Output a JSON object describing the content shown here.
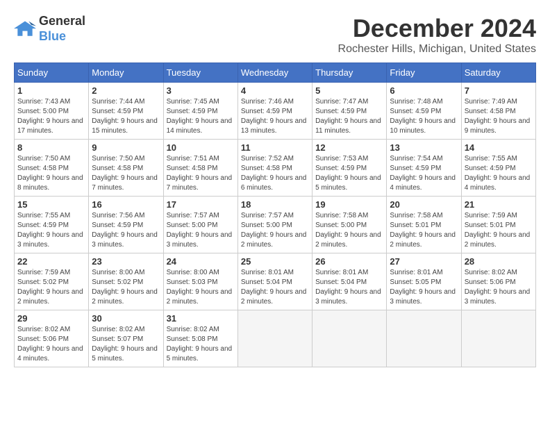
{
  "logo": {
    "line1": "General",
    "line2": "Blue"
  },
  "title": "December 2024",
  "location": "Rochester Hills, Michigan, United States",
  "weekdays": [
    "Sunday",
    "Monday",
    "Tuesday",
    "Wednesday",
    "Thursday",
    "Friday",
    "Saturday"
  ],
  "weeks": [
    [
      {
        "day": "1",
        "sunrise": "7:43 AM",
        "sunset": "5:00 PM",
        "daylight": "9 hours and 17 minutes."
      },
      {
        "day": "2",
        "sunrise": "7:44 AM",
        "sunset": "4:59 PM",
        "daylight": "9 hours and 15 minutes."
      },
      {
        "day": "3",
        "sunrise": "7:45 AM",
        "sunset": "4:59 PM",
        "daylight": "9 hours and 14 minutes."
      },
      {
        "day": "4",
        "sunrise": "7:46 AM",
        "sunset": "4:59 PM",
        "daylight": "9 hours and 13 minutes."
      },
      {
        "day": "5",
        "sunrise": "7:47 AM",
        "sunset": "4:59 PM",
        "daylight": "9 hours and 11 minutes."
      },
      {
        "day": "6",
        "sunrise": "7:48 AM",
        "sunset": "4:59 PM",
        "daylight": "9 hours and 10 minutes."
      },
      {
        "day": "7",
        "sunrise": "7:49 AM",
        "sunset": "4:58 PM",
        "daylight": "9 hours and 9 minutes."
      }
    ],
    [
      {
        "day": "8",
        "sunrise": "7:50 AM",
        "sunset": "4:58 PM",
        "daylight": "9 hours and 8 minutes."
      },
      {
        "day": "9",
        "sunrise": "7:50 AM",
        "sunset": "4:58 PM",
        "daylight": "9 hours and 7 minutes."
      },
      {
        "day": "10",
        "sunrise": "7:51 AM",
        "sunset": "4:58 PM",
        "daylight": "9 hours and 7 minutes."
      },
      {
        "day": "11",
        "sunrise": "7:52 AM",
        "sunset": "4:58 PM",
        "daylight": "9 hours and 6 minutes."
      },
      {
        "day": "12",
        "sunrise": "7:53 AM",
        "sunset": "4:59 PM",
        "daylight": "9 hours and 5 minutes."
      },
      {
        "day": "13",
        "sunrise": "7:54 AM",
        "sunset": "4:59 PM",
        "daylight": "9 hours and 4 minutes."
      },
      {
        "day": "14",
        "sunrise": "7:55 AM",
        "sunset": "4:59 PM",
        "daylight": "9 hours and 4 minutes."
      }
    ],
    [
      {
        "day": "15",
        "sunrise": "7:55 AM",
        "sunset": "4:59 PM",
        "daylight": "9 hours and 3 minutes."
      },
      {
        "day": "16",
        "sunrise": "7:56 AM",
        "sunset": "4:59 PM",
        "daylight": "9 hours and 3 minutes."
      },
      {
        "day": "17",
        "sunrise": "7:57 AM",
        "sunset": "5:00 PM",
        "daylight": "9 hours and 3 minutes."
      },
      {
        "day": "18",
        "sunrise": "7:57 AM",
        "sunset": "5:00 PM",
        "daylight": "9 hours and 2 minutes."
      },
      {
        "day": "19",
        "sunrise": "7:58 AM",
        "sunset": "5:00 PM",
        "daylight": "9 hours and 2 minutes."
      },
      {
        "day": "20",
        "sunrise": "7:58 AM",
        "sunset": "5:01 PM",
        "daylight": "9 hours and 2 minutes."
      },
      {
        "day": "21",
        "sunrise": "7:59 AM",
        "sunset": "5:01 PM",
        "daylight": "9 hours and 2 minutes."
      }
    ],
    [
      {
        "day": "22",
        "sunrise": "7:59 AM",
        "sunset": "5:02 PM",
        "daylight": "9 hours and 2 minutes."
      },
      {
        "day": "23",
        "sunrise": "8:00 AM",
        "sunset": "5:02 PM",
        "daylight": "9 hours and 2 minutes."
      },
      {
        "day": "24",
        "sunrise": "8:00 AM",
        "sunset": "5:03 PM",
        "daylight": "9 hours and 2 minutes."
      },
      {
        "day": "25",
        "sunrise": "8:01 AM",
        "sunset": "5:04 PM",
        "daylight": "9 hours and 2 minutes."
      },
      {
        "day": "26",
        "sunrise": "8:01 AM",
        "sunset": "5:04 PM",
        "daylight": "9 hours and 3 minutes."
      },
      {
        "day": "27",
        "sunrise": "8:01 AM",
        "sunset": "5:05 PM",
        "daylight": "9 hours and 3 minutes."
      },
      {
        "day": "28",
        "sunrise": "8:02 AM",
        "sunset": "5:06 PM",
        "daylight": "9 hours and 3 minutes."
      }
    ],
    [
      {
        "day": "29",
        "sunrise": "8:02 AM",
        "sunset": "5:06 PM",
        "daylight": "9 hours and 4 minutes."
      },
      {
        "day": "30",
        "sunrise": "8:02 AM",
        "sunset": "5:07 PM",
        "daylight": "9 hours and 5 minutes."
      },
      {
        "day": "31",
        "sunrise": "8:02 AM",
        "sunset": "5:08 PM",
        "daylight": "9 hours and 5 minutes."
      },
      null,
      null,
      null,
      null
    ]
  ]
}
